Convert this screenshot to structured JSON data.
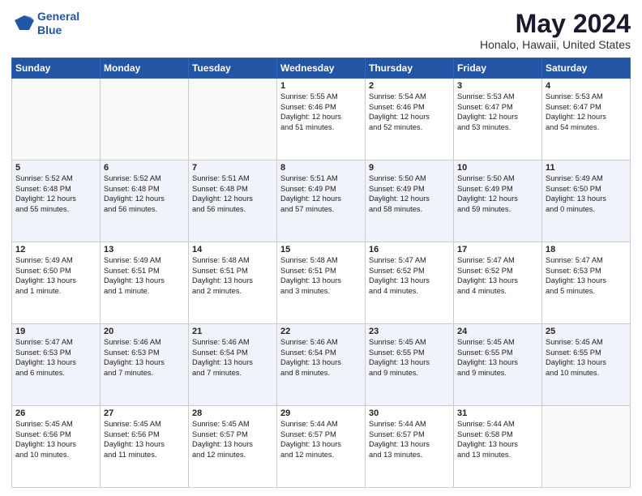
{
  "logo": {
    "line1": "General",
    "line2": "Blue"
  },
  "title": "May 2024",
  "subtitle": "Honalo, Hawaii, United States",
  "days_of_week": [
    "Sunday",
    "Monday",
    "Tuesday",
    "Wednesday",
    "Thursday",
    "Friday",
    "Saturday"
  ],
  "weeks": [
    [
      {
        "day": "",
        "info": ""
      },
      {
        "day": "",
        "info": ""
      },
      {
        "day": "",
        "info": ""
      },
      {
        "day": "1",
        "info": "Sunrise: 5:55 AM\nSunset: 6:46 PM\nDaylight: 12 hours\nand 51 minutes."
      },
      {
        "day": "2",
        "info": "Sunrise: 5:54 AM\nSunset: 6:46 PM\nDaylight: 12 hours\nand 52 minutes."
      },
      {
        "day": "3",
        "info": "Sunrise: 5:53 AM\nSunset: 6:47 PM\nDaylight: 12 hours\nand 53 minutes."
      },
      {
        "day": "4",
        "info": "Sunrise: 5:53 AM\nSunset: 6:47 PM\nDaylight: 12 hours\nand 54 minutes."
      }
    ],
    [
      {
        "day": "5",
        "info": "Sunrise: 5:52 AM\nSunset: 6:48 PM\nDaylight: 12 hours\nand 55 minutes."
      },
      {
        "day": "6",
        "info": "Sunrise: 5:52 AM\nSunset: 6:48 PM\nDaylight: 12 hours\nand 56 minutes."
      },
      {
        "day": "7",
        "info": "Sunrise: 5:51 AM\nSunset: 6:48 PM\nDaylight: 12 hours\nand 56 minutes."
      },
      {
        "day": "8",
        "info": "Sunrise: 5:51 AM\nSunset: 6:49 PM\nDaylight: 12 hours\nand 57 minutes."
      },
      {
        "day": "9",
        "info": "Sunrise: 5:50 AM\nSunset: 6:49 PM\nDaylight: 12 hours\nand 58 minutes."
      },
      {
        "day": "10",
        "info": "Sunrise: 5:50 AM\nSunset: 6:49 PM\nDaylight: 12 hours\nand 59 minutes."
      },
      {
        "day": "11",
        "info": "Sunrise: 5:49 AM\nSunset: 6:50 PM\nDaylight: 13 hours\nand 0 minutes."
      }
    ],
    [
      {
        "day": "12",
        "info": "Sunrise: 5:49 AM\nSunset: 6:50 PM\nDaylight: 13 hours\nand 1 minute."
      },
      {
        "day": "13",
        "info": "Sunrise: 5:49 AM\nSunset: 6:51 PM\nDaylight: 13 hours\nand 1 minute."
      },
      {
        "day": "14",
        "info": "Sunrise: 5:48 AM\nSunset: 6:51 PM\nDaylight: 13 hours\nand 2 minutes."
      },
      {
        "day": "15",
        "info": "Sunrise: 5:48 AM\nSunset: 6:51 PM\nDaylight: 13 hours\nand 3 minutes."
      },
      {
        "day": "16",
        "info": "Sunrise: 5:47 AM\nSunset: 6:52 PM\nDaylight: 13 hours\nand 4 minutes."
      },
      {
        "day": "17",
        "info": "Sunrise: 5:47 AM\nSunset: 6:52 PM\nDaylight: 13 hours\nand 4 minutes."
      },
      {
        "day": "18",
        "info": "Sunrise: 5:47 AM\nSunset: 6:53 PM\nDaylight: 13 hours\nand 5 minutes."
      }
    ],
    [
      {
        "day": "19",
        "info": "Sunrise: 5:47 AM\nSunset: 6:53 PM\nDaylight: 13 hours\nand 6 minutes."
      },
      {
        "day": "20",
        "info": "Sunrise: 5:46 AM\nSunset: 6:53 PM\nDaylight: 13 hours\nand 7 minutes."
      },
      {
        "day": "21",
        "info": "Sunrise: 5:46 AM\nSunset: 6:54 PM\nDaylight: 13 hours\nand 7 minutes."
      },
      {
        "day": "22",
        "info": "Sunrise: 5:46 AM\nSunset: 6:54 PM\nDaylight: 13 hours\nand 8 minutes."
      },
      {
        "day": "23",
        "info": "Sunrise: 5:45 AM\nSunset: 6:55 PM\nDaylight: 13 hours\nand 9 minutes."
      },
      {
        "day": "24",
        "info": "Sunrise: 5:45 AM\nSunset: 6:55 PM\nDaylight: 13 hours\nand 9 minutes."
      },
      {
        "day": "25",
        "info": "Sunrise: 5:45 AM\nSunset: 6:55 PM\nDaylight: 13 hours\nand 10 minutes."
      }
    ],
    [
      {
        "day": "26",
        "info": "Sunrise: 5:45 AM\nSunset: 6:56 PM\nDaylight: 13 hours\nand 10 minutes."
      },
      {
        "day": "27",
        "info": "Sunrise: 5:45 AM\nSunset: 6:56 PM\nDaylight: 13 hours\nand 11 minutes."
      },
      {
        "day": "28",
        "info": "Sunrise: 5:45 AM\nSunset: 6:57 PM\nDaylight: 13 hours\nand 12 minutes."
      },
      {
        "day": "29",
        "info": "Sunrise: 5:44 AM\nSunset: 6:57 PM\nDaylight: 13 hours\nand 12 minutes."
      },
      {
        "day": "30",
        "info": "Sunrise: 5:44 AM\nSunset: 6:57 PM\nDaylight: 13 hours\nand 13 minutes."
      },
      {
        "day": "31",
        "info": "Sunrise: 5:44 AM\nSunset: 6:58 PM\nDaylight: 13 hours\nand 13 minutes."
      },
      {
        "day": "",
        "info": ""
      }
    ]
  ]
}
